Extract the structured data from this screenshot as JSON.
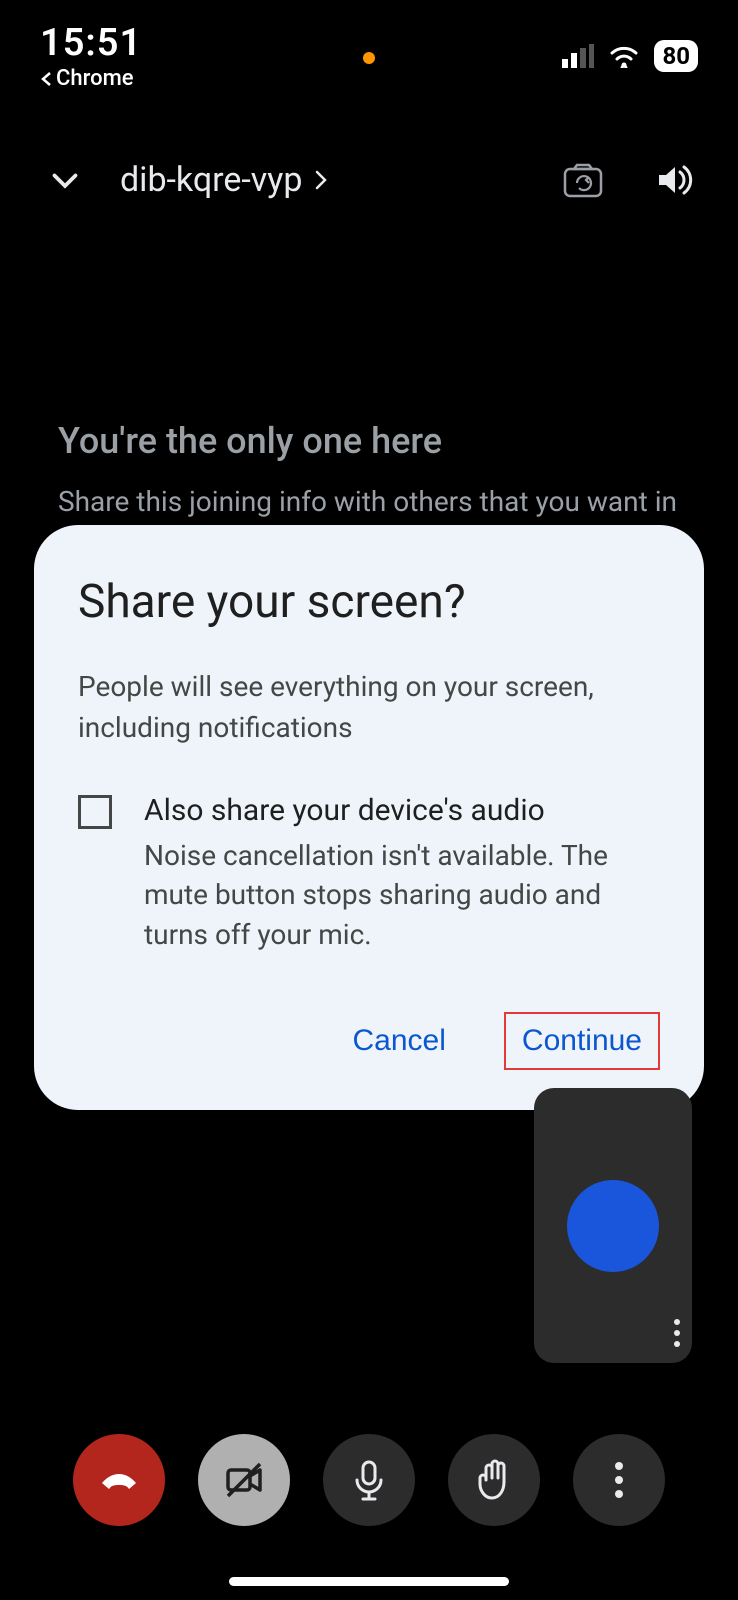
{
  "status": {
    "time": "15:51",
    "back_app": "Chrome",
    "battery": "80"
  },
  "meeting": {
    "code": "dib-kqre-vyp",
    "only_one_title": "You're the only one here",
    "share_prompt": "Share this joining info with others that you want in"
  },
  "dialog": {
    "title": "Share your screen?",
    "description": "People will see everything on your screen, including notifications",
    "checkbox_label": "Also share your device's audio",
    "checkbox_help": "Noise cancellation isn't available. The mute button stops sharing audio and turns off your mic.",
    "cancel": "Cancel",
    "continue": "Continue"
  }
}
